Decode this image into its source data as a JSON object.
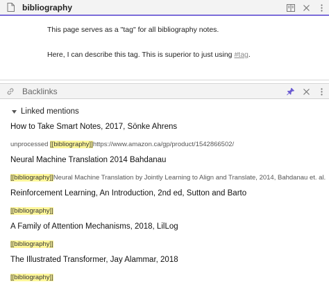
{
  "top_pane": {
    "title": "bibliography",
    "body_line1": "This page serves as a \"tag\" for all bibliography notes.",
    "body_line2_prefix": "Here, I can describe this tag. This is superior to just using ",
    "body_line2_tag": "#tag",
    "body_line2_suffix": "."
  },
  "backlinks_pane": {
    "title": "Backlinks",
    "section_label": "Linked mentions",
    "items": [
      {
        "title": "How to Take Smart Notes, 2017, Sönke Ahrens",
        "before": "unprocessed ",
        "link": "[[bibliography]]",
        "after": "https://www.amazon.ca/gp/product/1542866502/"
      },
      {
        "title": "Neural Machine Translation 2014 Bahdanau",
        "before": "",
        "link": "[[bibliography]]",
        "after": "Neural Machine Translation by Jointly Learning to Align and Translate, 2014, Bahdanau et. al."
      },
      {
        "title": "Reinforcement Learning, An Introduction, 2nd ed, Sutton and Barto",
        "before": "",
        "link": "[[bibliography]]",
        "after": ""
      },
      {
        "title": "A Family of Attention Mechanisms, 2018, LilLog",
        "before": "",
        "link": "[[bibliography]]",
        "after": ""
      },
      {
        "title": "The Illustrated Transformer, Jay Alammar, 2018",
        "before": "",
        "link": "[[bibliography]]",
        "after": ""
      }
    ]
  },
  "colors": {
    "accent": "#7b6cd9",
    "highlight": "#fff79a",
    "pin": "#6b5bd2"
  },
  "icons": {
    "file": "file-icon",
    "reading": "book-open-icon",
    "close": "close-icon",
    "more": "more-vertical-icon",
    "link": "link-icon",
    "pin": "pin-icon",
    "caret": "caret-down-icon"
  }
}
